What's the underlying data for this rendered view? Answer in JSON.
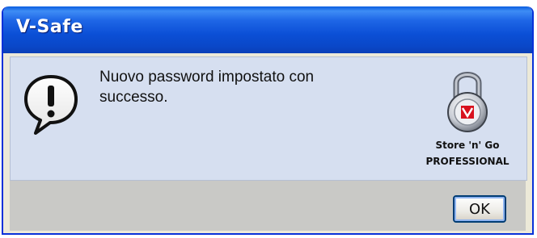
{
  "window": {
    "title": "V-Safe"
  },
  "dialog": {
    "icon": "warning-exclamation-icon",
    "message": "Nuovo password impostato con\nsuccesso."
  },
  "logo": {
    "icon": "padlock-icon",
    "line1": "Store 'n' Go",
    "line2": "PROFESSIONAL"
  },
  "buttons": {
    "ok_label": "OK"
  },
  "colors": {
    "titlebar": "#0a4fd6",
    "content_bg": "#d6dff0",
    "footer_bg": "#c9c9c6",
    "logo_accent": "#d8121e"
  }
}
